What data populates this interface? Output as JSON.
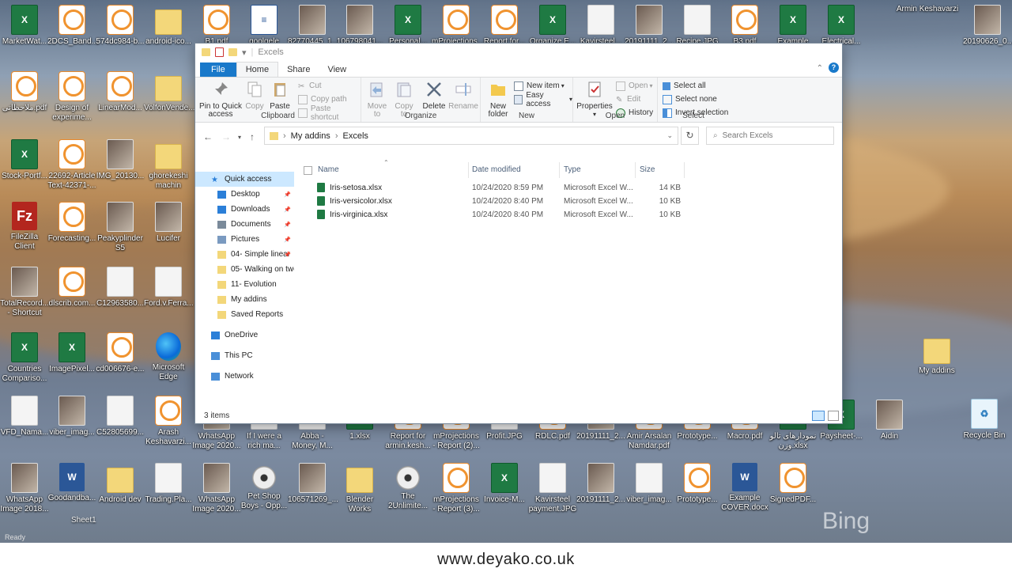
{
  "window": {
    "title": "Excels",
    "tabs": [
      "File",
      "Home",
      "Share",
      "View"
    ],
    "ribbon": {
      "clipboard": {
        "label": "Clipboard",
        "pin_to_quick_access": "Pin to Quick access",
        "copy": "Copy",
        "paste": "Paste",
        "cut": "Cut",
        "copy_path": "Copy path",
        "paste_shortcut": "Paste shortcut"
      },
      "organize": {
        "label": "Organize",
        "move_to": "Move to",
        "copy_to": "Copy to",
        "delete": "Delete",
        "rename": "Rename"
      },
      "new": {
        "label": "New",
        "new_folder": "New folder",
        "new_item": "New item",
        "easy_access": "Easy access"
      },
      "open": {
        "label": "Open",
        "properties": "Properties",
        "open": "Open",
        "edit": "Edit",
        "history": "History"
      },
      "select": {
        "label": "Select",
        "select_all": "Select all",
        "select_none": "Select none",
        "invert_selection": "Invert selection"
      }
    },
    "address": {
      "segments": [
        "My addins",
        "Excels"
      ],
      "search_placeholder": "Search Excels"
    },
    "nav": [
      {
        "label": "Quick access",
        "icon": "star-icon"
      },
      {
        "label": "Desktop",
        "icon": "desktop-icon",
        "pinned": true
      },
      {
        "label": "Downloads",
        "icon": "download-icon",
        "pinned": true
      },
      {
        "label": "Documents",
        "icon": "document-icon",
        "pinned": true
      },
      {
        "label": "Pictures",
        "icon": "pictures-icon",
        "pinned": true
      },
      {
        "label": "04- Simple linear",
        "icon": "folder-icon",
        "pinned": true
      },
      {
        "label": "05- Walking on two",
        "icon": "folder-icon"
      },
      {
        "label": "11- Evolution",
        "icon": "folder-icon"
      },
      {
        "label": "My addins",
        "icon": "folder-icon"
      },
      {
        "label": "Saved Reports",
        "icon": "folder-icon"
      },
      {
        "label": "OneDrive",
        "icon": "cloud-icon"
      },
      {
        "label": "This PC",
        "icon": "computer-icon"
      },
      {
        "label": "Network",
        "icon": "network-icon"
      }
    ],
    "columns": [
      "Name",
      "Date modified",
      "Type",
      "Size"
    ],
    "files": [
      {
        "name": "Iris-setosa.xlsx",
        "date": "10/24/2020 8:59 PM",
        "type": "Microsoft Excel W...",
        "size": "14 KB"
      },
      {
        "name": "Iris-versicolor.xlsx",
        "date": "10/24/2020 8:40 PM",
        "type": "Microsoft Excel W...",
        "size": "10 KB"
      },
      {
        "name": "Iris-virginica.xlsx",
        "date": "10/24/2020 8:40 PM",
        "type": "Microsoft Excel W...",
        "size": "10 KB"
      }
    ],
    "status": "3 items"
  },
  "desktop": {
    "top_row": [
      {
        "label": "MarketWat...",
        "type": "xl"
      },
      {
        "label": "2DCS_Band...",
        "type": "pdf"
      },
      {
        "label": "574dc984-b...",
        "type": "pdf"
      },
      {
        "label": "android-ico...",
        "type": "folder"
      },
      {
        "label": "B1.pdf",
        "type": "pdf"
      },
      {
        "label": "goolgele",
        "type": "doc"
      },
      {
        "label": "82770445_1...",
        "type": "img"
      },
      {
        "label": "106798041...",
        "type": "img"
      },
      {
        "label": "Personal...",
        "type": "xl"
      },
      {
        "label": "mProjections...",
        "type": "pdf"
      },
      {
        "label": "Report for...",
        "type": "pdf"
      },
      {
        "label": "Organize E...",
        "type": "xl"
      },
      {
        "label": "Kavirsteel...",
        "type": "white"
      },
      {
        "label": "20191111_2...",
        "type": "img"
      },
      {
        "label": "Recipe.JPG",
        "type": "white"
      },
      {
        "label": "B3.pdf",
        "type": "pdf"
      },
      {
        "label": "Example ZEI...",
        "type": "xl"
      },
      {
        "label": "Electrical...",
        "type": "xl"
      }
    ],
    "left_icons": [
      {
        "label": "ملاحظاتی.pdf",
        "type": "pdf"
      },
      {
        "label": "Design of experime...",
        "type": "pdf"
      },
      {
        "label": "LinearMod...",
        "type": "pdf"
      },
      {
        "label": "VolfonVende...",
        "type": "folder"
      },
      {
        "label": "Stock-Portf...",
        "type": "xl"
      },
      {
        "label": "22692-Article Text-42371-...",
        "type": "pdf"
      },
      {
        "label": "IMG_20130...",
        "type": "img"
      },
      {
        "label": "ghorekeshi machin",
        "type": "folder"
      },
      {
        "label": "FileZilla Client",
        "type": "fz"
      },
      {
        "label": "Forecasting...",
        "type": "pdf"
      },
      {
        "label": "Peakyplinder S5",
        "type": "img"
      },
      {
        "label": "Lucifer",
        "type": "img"
      },
      {
        "label": "TotalRecord... - Shortcut",
        "type": "img"
      },
      {
        "label": "dlscrib.com...",
        "type": "pdf"
      },
      {
        "label": "C12963580...",
        "type": "white"
      },
      {
        "label": "Ford.v.Ferra...",
        "type": "white"
      },
      {
        "label": "Countries Compariso...",
        "type": "xl"
      },
      {
        "label": "ImagePixel...",
        "type": "xl"
      },
      {
        "label": "cd006676-e...",
        "type": "pdf"
      },
      {
        "label": "Microsoft Edge",
        "type": "edge"
      },
      {
        "label": "VFD_Nama...",
        "type": "white"
      },
      {
        "label": "viber_imag...",
        "type": "img"
      },
      {
        "label": "C52805699...",
        "type": "white"
      },
      {
        "label": "Arash Keshavarzi...",
        "type": "pdf"
      }
    ],
    "row_547": [
      {
        "label": "WhatsApp Image 2020...",
        "type": "img"
      },
      {
        "label": "If I were a rich ma...",
        "type": "white"
      },
      {
        "label": "Abba - Money, M...",
        "type": "white"
      },
      {
        "label": "1.xlsx",
        "type": "xl"
      },
      {
        "label": "Report for armin.kesh...",
        "type": "pdf"
      },
      {
        "label": "mProjections - Report (2)...",
        "type": "pdf"
      },
      {
        "label": "Profit.JPG",
        "type": "white"
      },
      {
        "label": "RDLC.pdf",
        "type": "pdf"
      },
      {
        "label": "20191111_2...",
        "type": "img"
      },
      {
        "label": "Amir Arsalan Namdar.pdf",
        "type": "pdf"
      },
      {
        "label": "Prototype...",
        "type": "pdf"
      },
      {
        "label": "Macro.pdf",
        "type": "pdf"
      },
      {
        "label": "نمودارهای تالو وزن.xlsx",
        "type": "xl"
      },
      {
        "label": "Paysheet-...",
        "type": "xl"
      },
      {
        "label": "Aidin",
        "type": "img"
      }
    ],
    "bottom_row": [
      {
        "label": "WhatsApp Image 2018...",
        "type": "img"
      },
      {
        "label": "Goodandba...",
        "type": "word"
      },
      {
        "label": "Android dev",
        "type": "folder"
      },
      {
        "label": "Trading.Pla...",
        "type": "white"
      },
      {
        "label": "WhatsApp Image 2020...",
        "type": "img"
      },
      {
        "label": "Pet Shop Boys - Opp...",
        "type": "disc"
      },
      {
        "label": "106571269_...",
        "type": "img"
      },
      {
        "label": "Blender Works",
        "type": "folder"
      },
      {
        "label": "The 2Unlimite...",
        "type": "disc"
      },
      {
        "label": "mProjections - Report (3)...",
        "type": "pdf"
      },
      {
        "label": "Invoice-M...",
        "type": "xl"
      },
      {
        "label": "Kavirsteel payment.JPG",
        "type": "white"
      },
      {
        "label": "20191111_2...",
        "type": "img"
      },
      {
        "label": "viber_imag...",
        "type": "white"
      },
      {
        "label": "Prototype...",
        "type": "pdf"
      },
      {
        "label": "Example COVER.docx",
        "type": "word"
      },
      {
        "label": "SignedPDF...",
        "type": "pdf"
      }
    ],
    "right_icons": [
      {
        "label": "Armin Keshavarzi",
        "type": "text"
      },
      {
        "label": "20190626_0...",
        "type": "img"
      },
      {
        "label": "My addins",
        "type": "folder"
      },
      {
        "label": "Recycle Bin",
        "type": "recycle"
      }
    ],
    "sheet_tab": "Sheet1",
    "ready": "Ready",
    "bing": "Bing"
  },
  "footer": "www.deyako.co.uk",
  "colors": {
    "accent": "#1979ca",
    "excel_green": "#1f7a43",
    "selection": "#cce8ff"
  }
}
